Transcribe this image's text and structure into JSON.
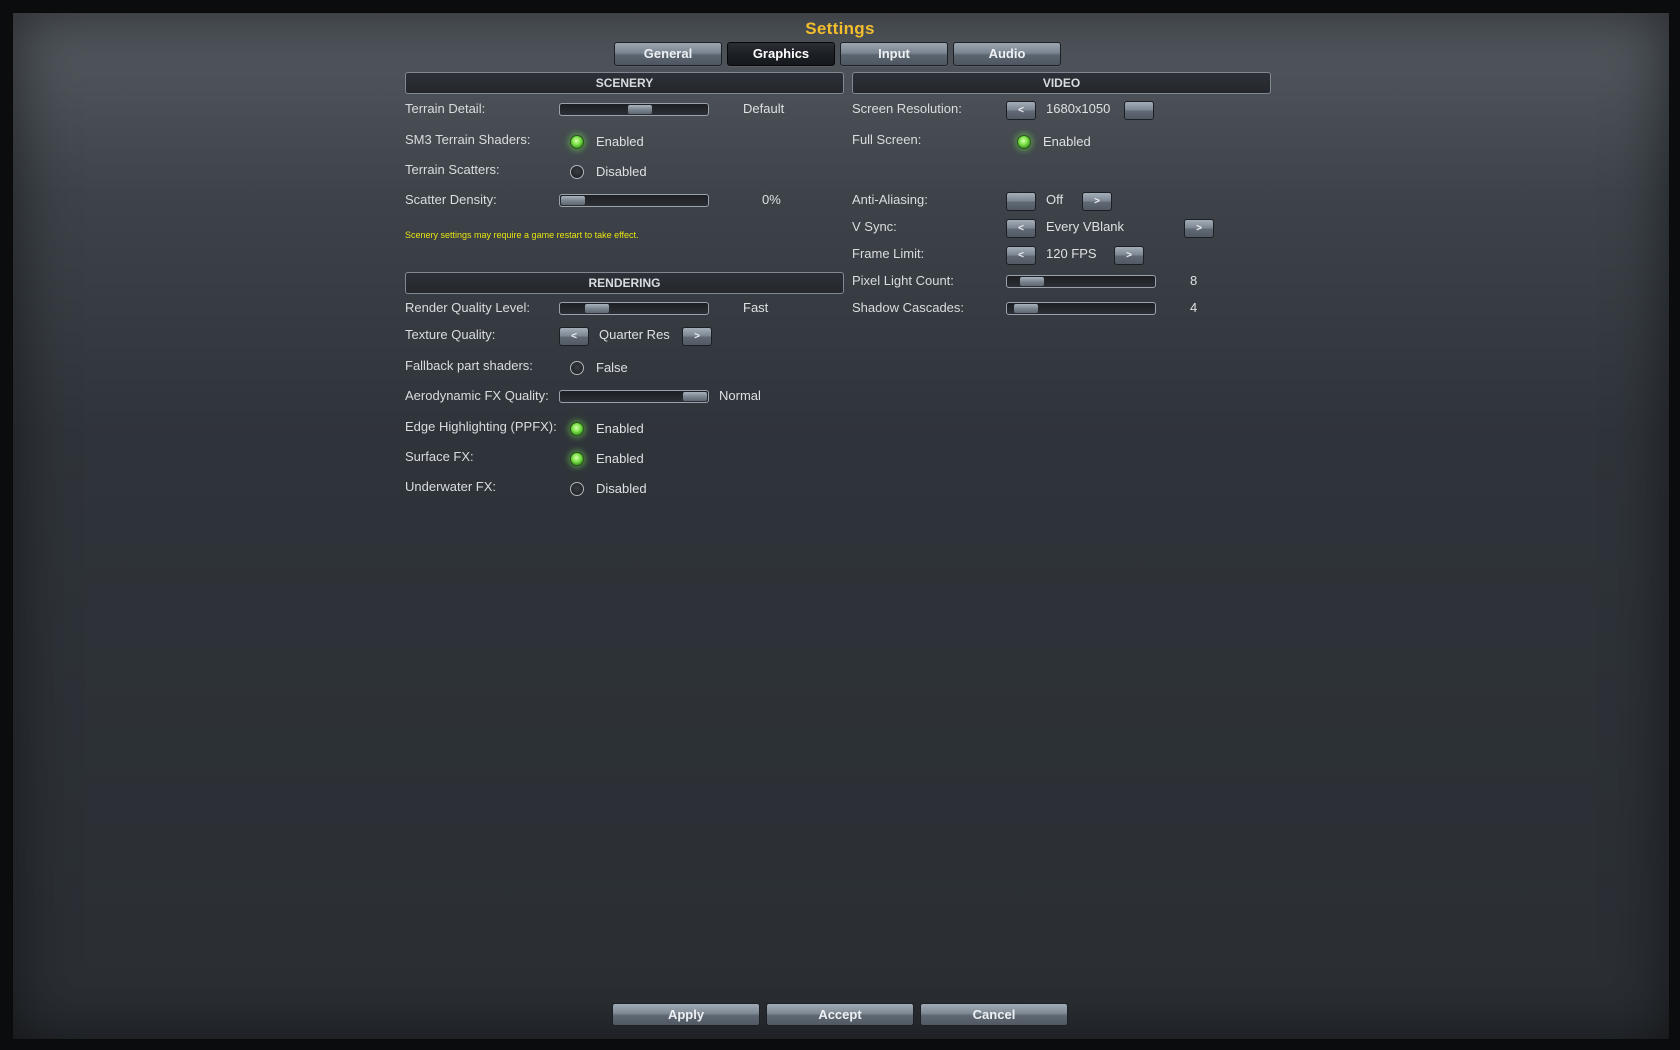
{
  "title": "Settings",
  "tabs": [
    {
      "label": "General",
      "active": false
    },
    {
      "label": "Graphics",
      "active": true
    },
    {
      "label": "Input",
      "active": false
    },
    {
      "label": "Audio",
      "active": false
    }
  ],
  "scenery": {
    "header": "SCENERY",
    "terrain_detail": {
      "label": "Terrain Detail:",
      "value": "Default",
      "level": 0.55
    },
    "sm3_terrain_shaders": {
      "label": "SM3 Terrain Shaders:",
      "value": "Enabled",
      "on": true
    },
    "terrain_scatters": {
      "label": "Terrain Scatters:",
      "value": "Disabled",
      "on": false
    },
    "scatter_density": {
      "label": "Scatter Density:",
      "value": "0%",
      "level": 0.0
    },
    "note": "Scenery settings may require a game restart to take effect."
  },
  "rendering": {
    "header": "RENDERING",
    "render_quality": {
      "label": "Render Quality Level:",
      "value": "Fast",
      "level": 0.2
    },
    "texture_quality": {
      "label": "Texture Quality:",
      "value": "Quarter Res",
      "prev": "<",
      "next": ">"
    },
    "fallback_part_shaders": {
      "label": "Fallback part shaders:",
      "value": "False",
      "on": false
    },
    "aero_fx_quality": {
      "label": "Aerodynamic FX Quality:",
      "value": "Normal",
      "level": 1.0
    },
    "edge_highlighting": {
      "label": "Edge Highlighting (PPFX):",
      "value": "Enabled",
      "on": true
    },
    "surface_fx": {
      "label": "Surface FX:",
      "value": "Enabled",
      "on": true
    },
    "underwater_fx": {
      "label": "Underwater FX:",
      "value": "Disabled",
      "on": false
    }
  },
  "video": {
    "header": "VIDEO",
    "screen_resolution": {
      "label": "Screen Resolution:",
      "value": "1680x1050",
      "prev": "<",
      "next": ""
    },
    "full_screen": {
      "label": "Full Screen:",
      "value": "Enabled",
      "on": true
    },
    "anti_aliasing": {
      "label": "Anti-Aliasing:",
      "value": "Off",
      "prev": "",
      "next": ">"
    },
    "v_sync": {
      "label": "V Sync:",
      "value": "Every VBlank",
      "prev": "<",
      "next": ">"
    },
    "frame_limit": {
      "label": "Frame Limit:",
      "value": "120 FPS",
      "prev": "<",
      "next": ">"
    },
    "pixel_light_count": {
      "label": "Pixel Light Count:",
      "value": "8",
      "level": 0.1
    },
    "shadow_cascades": {
      "label": "Shadow Cascades:",
      "value": "4",
      "level": 0.05
    }
  },
  "footer": {
    "apply": "Apply",
    "accept": "Accept",
    "cancel": "Cancel"
  }
}
